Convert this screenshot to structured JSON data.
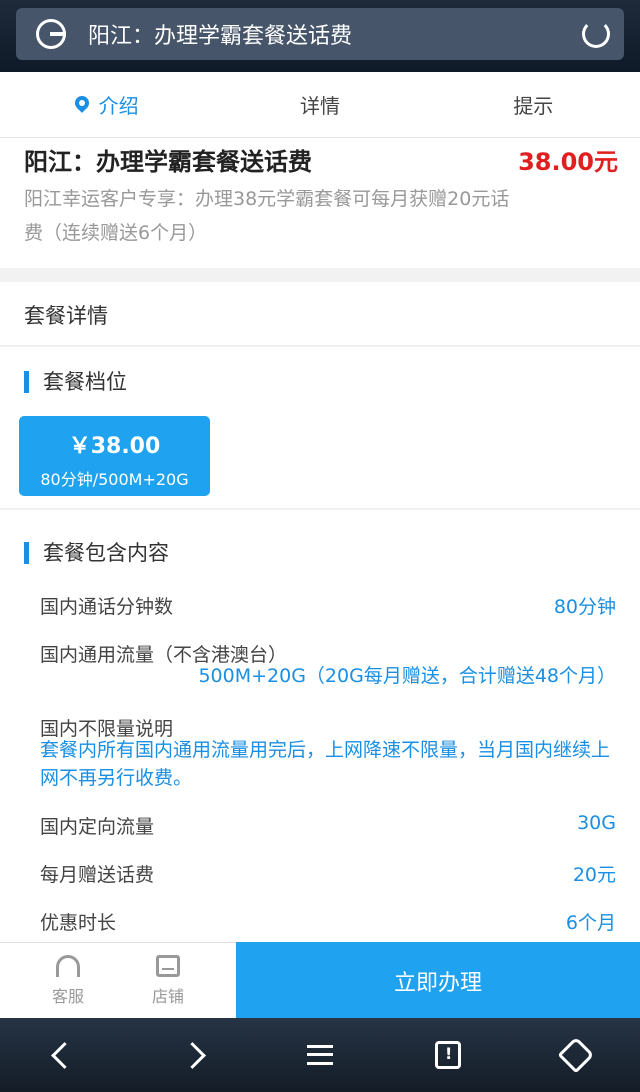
{
  "search": {
    "text": "阳江：办理学霸套餐送话费"
  },
  "tabs": [
    {
      "label": "介绍"
    },
    {
      "label": "详情"
    },
    {
      "label": "提示"
    }
  ],
  "intro": {
    "title": "阳江：办理学霸套餐送话费",
    "price": "38.00元",
    "desc": "阳江幸运客户专享：办理38元学霸套餐可每月获赠20元话费（连续赠送6个月）"
  },
  "detail_header": "套餐详情",
  "tier": {
    "title": "套餐档位",
    "price": "￥38.00",
    "spec": "80分钟/500M+20G"
  },
  "contents": {
    "title": "套餐包含内容",
    "rows": [
      {
        "label": "国内通话分钟数",
        "value": "80分钟"
      },
      {
        "label": "国内通用流量（不含港澳台）",
        "value": "500M+20G（20G每月赠送，合计赠送48个月）"
      },
      {
        "label": "国内不限量说明",
        "value": "套餐内所有国内通用流量用完后，上网降速不限量，当月国内继续上网不再另行收费。"
      },
      {
        "label": "国内定向流量",
        "value": "30G"
      },
      {
        "label": "每月赠送话费",
        "value": "20元"
      },
      {
        "label": "优惠时长",
        "value": "6个月"
      }
    ]
  },
  "bottombar": {
    "service": "客服",
    "shop": "店铺",
    "apply": "立即办理"
  },
  "colors": {
    "accent": "#1fa3f0",
    "price": "#e02020"
  }
}
